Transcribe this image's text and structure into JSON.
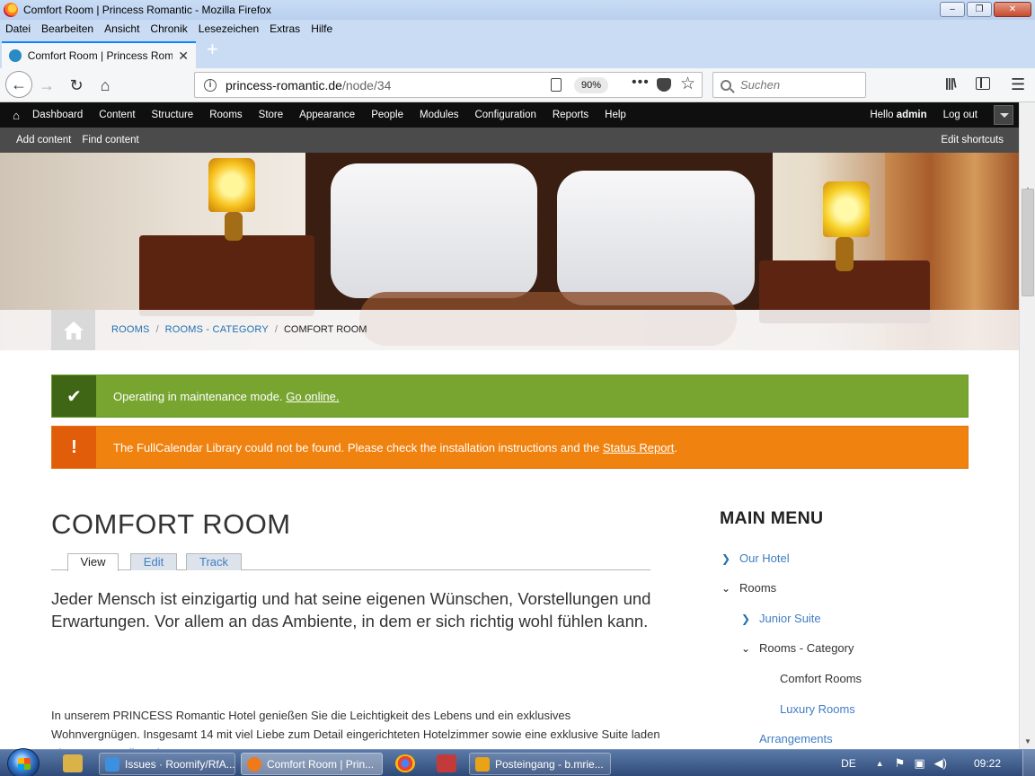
{
  "window": {
    "title": "Comfort Room | Princess Romantic - Mozilla Firefox",
    "minimize": "‒",
    "maximize": "❐",
    "close": "✕"
  },
  "menubar": [
    "Datei",
    "Bearbeiten",
    "Ansicht",
    "Chronik",
    "Lesezeichen",
    "Extras",
    "Hilfe"
  ],
  "tab": {
    "title": "Comfort Room | Princess Romantic",
    "close": "✕"
  },
  "newtab": "+",
  "navbar": {
    "url_host": "princess-romantic.de",
    "url_path": "/node/34",
    "zoom": "90%",
    "page_actions": "•••",
    "search_placeholder": "Suchen"
  },
  "admin_toolbar": {
    "items": [
      "Dashboard",
      "Content",
      "Structure",
      "Rooms",
      "Store",
      "Appearance",
      "People",
      "Modules",
      "Configuration",
      "Reports",
      "Help"
    ],
    "hello": "Hello",
    "user": "admin",
    "logout": "Log out"
  },
  "shortcuts": {
    "items": [
      "Add content",
      "Find content"
    ],
    "edit": "Edit shortcuts"
  },
  "breadcrumb": {
    "links": [
      "ROOMS",
      "ROOMS - CATEGORY"
    ],
    "separator": "/",
    "current": "COMFORT ROOM"
  },
  "messages": {
    "status_text": "Operating in maintenance mode. ",
    "status_link": "Go online.",
    "warning_text": "The FullCalendar Library could not be found. Please check the installation instructions and the ",
    "warning_link": "Status Report",
    "warning_end": "."
  },
  "content": {
    "title": "COMFORT ROOM",
    "tabs": [
      "View",
      "Edit",
      "Track"
    ],
    "lead": "Jeder Mensch ist einzigartig und hat seine eigenen Wünschen, Vorstellungen und Erwartungen. Vor allem an das Ambiente, in dem er sich richtig wohl fühlen kann.",
    "body": "In unserem PRINCESS Romantic Hotel genießen Sie die Leichtigkeit des Lebens und ein exklusives Wohnvergnügen. Insgesamt 14 mit viel Liebe zum Detail eingerichteten Hotelzimmer sowie eine exklusive Suite laden Sie zum Verweilen ein."
  },
  "sidebar": {
    "title": "MAIN MENU",
    "items": [
      {
        "label": "Our Hotel",
        "state": "collapsed",
        "link": true
      },
      {
        "label": "Rooms",
        "state": "expanded",
        "link": false
      },
      {
        "label": "Junior Suite",
        "state": "collapsed",
        "link": true
      },
      {
        "label": "Rooms - Category",
        "state": "expanded",
        "link": false
      },
      {
        "label": "Comfort Rooms",
        "state": "active",
        "link": false
      },
      {
        "label": "Luxury Rooms",
        "state": "leaf",
        "link": true
      },
      {
        "label": "Arrangements",
        "state": "leaf",
        "link": true
      }
    ]
  },
  "taskbar": {
    "items": [
      "Issues · Roomify/RfA...",
      "Comfort Room | Prin...",
      "Posteingang - b.mrie..."
    ],
    "lang": "DE",
    "time": "09:22"
  },
  "colors": {
    "status_green": "#77a52f",
    "warning_orange": "#f0820f",
    "link_blue": "#3f7ec2",
    "toolbar_black": "#0f0f0f"
  }
}
